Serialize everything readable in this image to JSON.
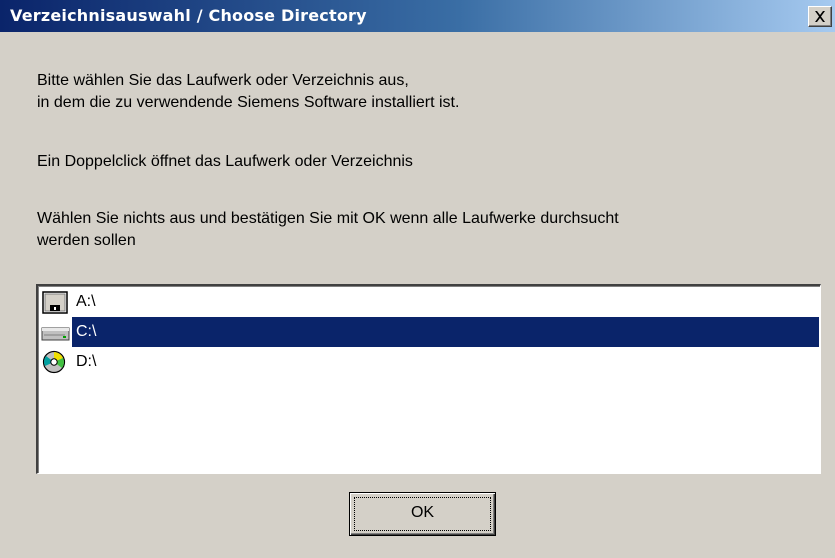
{
  "window": {
    "title": "Verzeichnisauswahl / Choose Directory",
    "close_symbol": "X"
  },
  "message": {
    "line1": "Bitte wählen Sie das Laufwerk oder Verzeichnis aus,",
    "line2": "in dem die zu verwendende Siemens Software installiert ist.",
    "line3": "Ein Doppelclick öffnet das Laufwerk oder Verzeichnis",
    "line4": "Wählen Sie nichts aus und bestätigen Sie mit OK wenn alle Laufwerke durchsucht",
    "line5": "werden sollen"
  },
  "drives": [
    {
      "label": "A:\\",
      "icon": "floppy-drive-icon",
      "selected": false
    },
    {
      "label": "C:\\",
      "icon": "hard-drive-icon",
      "selected": true
    },
    {
      "label": "D:\\",
      "icon": "cd-drive-icon",
      "selected": false
    }
  ],
  "buttons": {
    "ok_label": "OK"
  },
  "colors": {
    "title_start": "#0a246a",
    "title_end": "#a6caf0",
    "selection": "#0a246a",
    "face": "#d4d0c8"
  }
}
